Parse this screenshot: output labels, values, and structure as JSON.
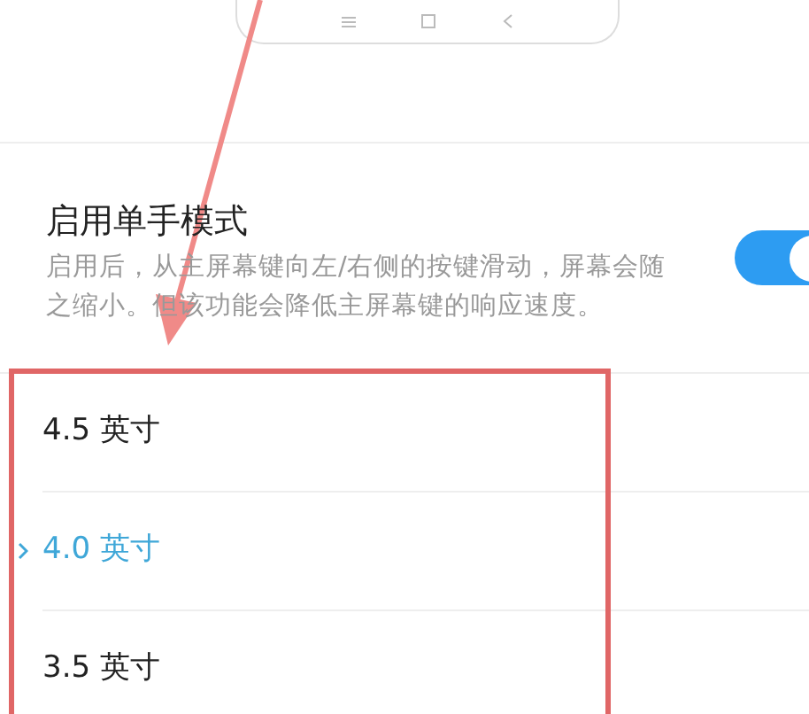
{
  "setting": {
    "title": "启用单手模式",
    "description": "启用后，从主屏幕键向左/右侧的按键滑动，屏幕会随之缩小。但该功能会降低主屏幕键的响应速度。",
    "on": true
  },
  "options": [
    {
      "label": "4.5 英寸",
      "selected": false
    },
    {
      "label": "4.0 英寸",
      "selected": true
    },
    {
      "label": "3.5 英寸",
      "selected": false
    }
  ]
}
